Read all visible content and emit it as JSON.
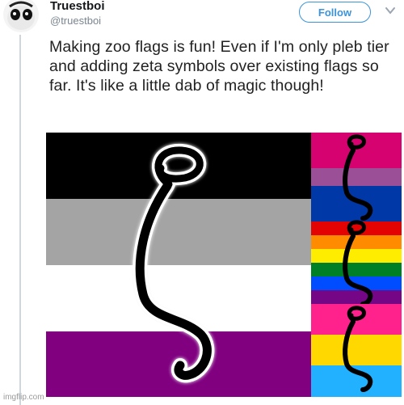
{
  "tweet": {
    "author_name": "Truestboi",
    "author_handle": "@truestboi",
    "follow_label": "Follow",
    "text": "Making zoo flags is fun! Even if I'm only pleb tier and adding zeta symbols over existing flags so far. It's like a little dab of magic though!"
  },
  "media": {
    "main_flag_stripes": [
      "#000000",
      "#a4a4a4",
      "#ffffff",
      "#800080"
    ],
    "bi_flag_stripes": [
      "#d60270",
      "#9b4f96",
      "#0038a8"
    ],
    "rainbow_flag_stripes": [
      "#e40303",
      "#ff8c00",
      "#ffed00",
      "#008026",
      "#004dff",
      "#750787"
    ],
    "pan_flag_stripes": [
      "#ff218c",
      "#ffd800",
      "#21b1ff"
    ],
    "symbol": "zeta-symbol"
  },
  "watermark": "imgflip.com",
  "icons": {
    "avatar": "avatar-icon",
    "menu": "chevron-down-icon"
  }
}
